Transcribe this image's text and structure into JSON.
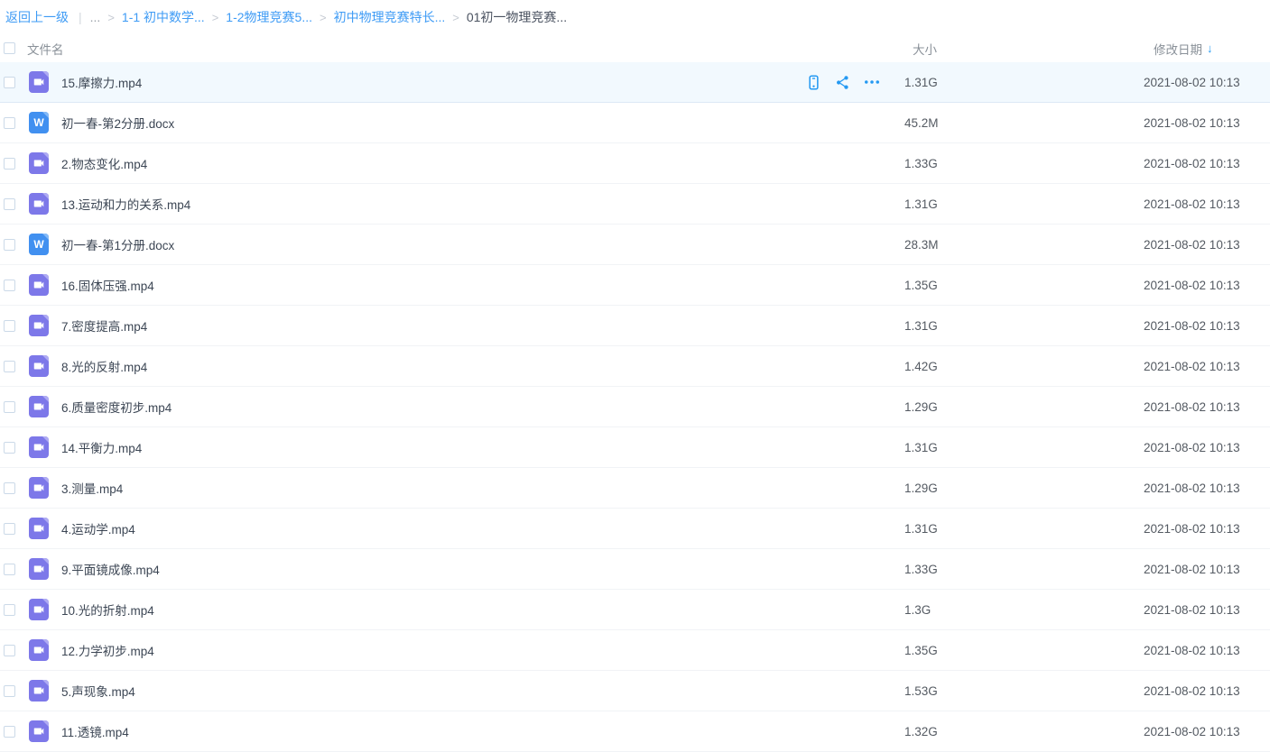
{
  "breadcrumb": {
    "back_label": "返回上一级",
    "pipe": "|",
    "collapsed": "...",
    "separator": ">",
    "items": [
      {
        "label": "1-1 初中数学...",
        "current": false
      },
      {
        "label": "1-2物理竞赛5...",
        "current": false
      },
      {
        "label": "初中物理竞赛特长...",
        "current": false
      },
      {
        "label": "01初一物理竞赛...",
        "current": true
      }
    ]
  },
  "table": {
    "columns": {
      "name": "文件名",
      "size": "大小",
      "date": "修改日期"
    },
    "sort_icon": "↓"
  },
  "row_actions": {
    "icons": [
      "phone-icon",
      "share-icon",
      "more-icon"
    ]
  },
  "file_type_glyphs": {
    "word": "W"
  },
  "files": [
    {
      "name": "15.摩擦力.mp4",
      "type": "video",
      "size": "1.31G",
      "date": "2021-08-02 10:13",
      "highlighted": true
    },
    {
      "name": "初一春-第2分册.docx",
      "type": "word",
      "size": "45.2M",
      "date": "2021-08-02 10:13"
    },
    {
      "name": "2.物态变化.mp4",
      "type": "video",
      "size": "1.33G",
      "date": "2021-08-02 10:13"
    },
    {
      "name": "13.运动和力的关系.mp4",
      "type": "video",
      "size": "1.31G",
      "date": "2021-08-02 10:13"
    },
    {
      "name": "初一春-第1分册.docx",
      "type": "word",
      "size": "28.3M",
      "date": "2021-08-02 10:13"
    },
    {
      "name": "16.固体压强.mp4",
      "type": "video",
      "size": "1.35G",
      "date": "2021-08-02 10:13"
    },
    {
      "name": "7.密度提高.mp4",
      "type": "video",
      "size": "1.31G",
      "date": "2021-08-02 10:13"
    },
    {
      "name": "8.光的反射.mp4",
      "type": "video",
      "size": "1.42G",
      "date": "2021-08-02 10:13"
    },
    {
      "name": "6.质量密度初步.mp4",
      "type": "video",
      "size": "1.29G",
      "date": "2021-08-02 10:13"
    },
    {
      "name": "14.平衡力.mp4",
      "type": "video",
      "size": "1.31G",
      "date": "2021-08-02 10:13"
    },
    {
      "name": "3.测量.mp4",
      "type": "video",
      "size": "1.29G",
      "date": "2021-08-02 10:13"
    },
    {
      "name": "4.运动学.mp4",
      "type": "video",
      "size": "1.31G",
      "date": "2021-08-02 10:13"
    },
    {
      "name": "9.平面镜成像.mp4",
      "type": "video",
      "size": "1.33G",
      "date": "2021-08-02 10:13"
    },
    {
      "name": "10.光的折射.mp4",
      "type": "video",
      "size": "1.3G",
      "date": "2021-08-02 10:13"
    },
    {
      "name": "12.力学初步.mp4",
      "type": "video",
      "size": "1.35G",
      "date": "2021-08-02 10:13"
    },
    {
      "name": "5.声现象.mp4",
      "type": "video",
      "size": "1.53G",
      "date": "2021-08-02 10:13"
    },
    {
      "name": "11.透镜.mp4",
      "type": "video",
      "size": "1.32G",
      "date": "2021-08-02 10:13"
    }
  ],
  "colors": {
    "accent": "#2499F2",
    "link_blue": "#3E9BF5",
    "video_icon": "#7D78E9",
    "word_icon": "#4190F0",
    "row_highlight": "#F2F9FE"
  }
}
